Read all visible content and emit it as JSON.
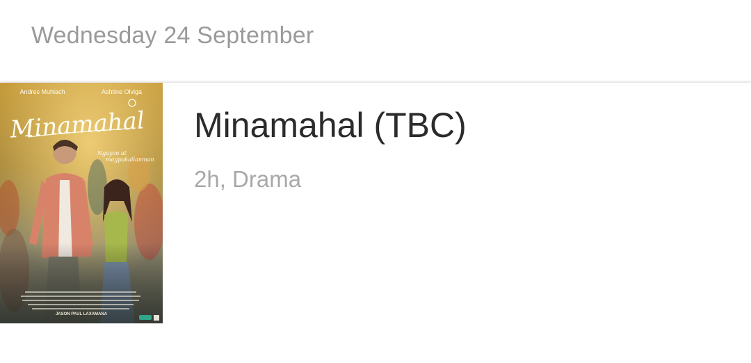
{
  "header": {
    "date": "Wednesday 24 September"
  },
  "movie": {
    "title": "Minamahal (TBC)",
    "meta": "2h, Drama",
    "poster": {
      "actor_left": "Andres Muhlach",
      "actor_right": "Ashtine Olviga",
      "logo": "Minamahal",
      "tagline_1": "Ngayon at",
      "tagline_2": "magpakailanman",
      "director": "JASON PAUL LAXAMANA"
    }
  },
  "colors": {
    "date_text": "#9a9a9a",
    "title_text": "#2b2b2b",
    "meta_text": "#a8a8a8"
  }
}
